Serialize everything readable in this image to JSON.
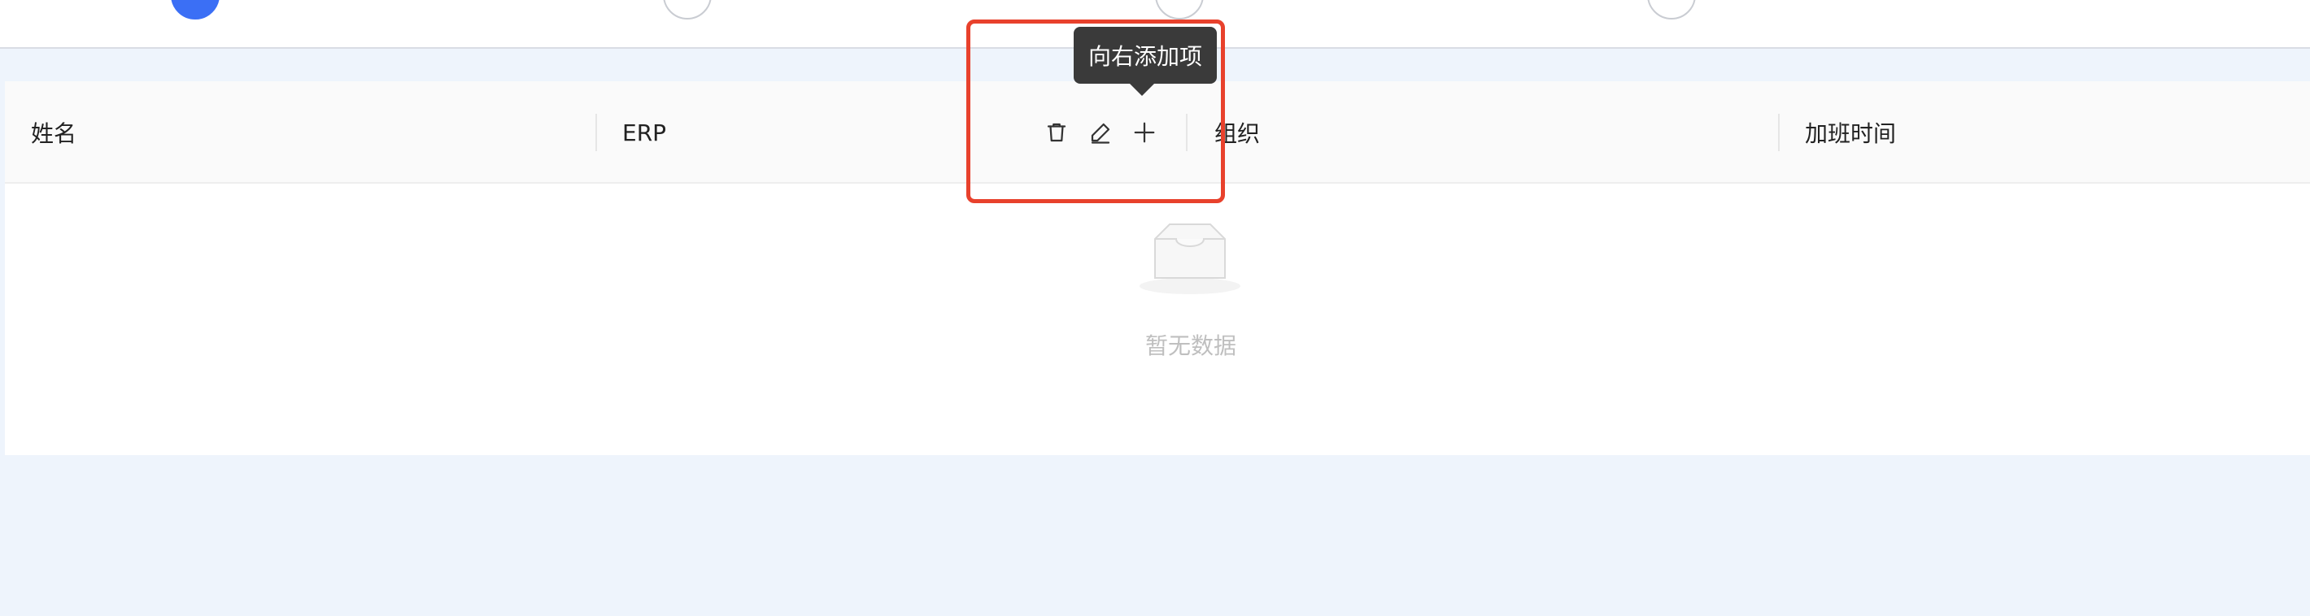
{
  "table": {
    "columns": [
      {
        "label": "姓名"
      },
      {
        "label": "ERP"
      },
      {
        "label": "组织"
      },
      {
        "label": "加班时间"
      }
    ],
    "empty_text": "暂无数据"
  },
  "tooltip": {
    "text": "向右添加项"
  },
  "icons": {
    "delete": "trash-icon",
    "edit": "pencil-icon",
    "add": "plus-icon",
    "empty": "inbox-icon"
  },
  "colors": {
    "accent": "#3b6ff5",
    "highlight": "#e8412c",
    "tooltip_bg": "#3a3a3a",
    "page_bg": "#eef4fc"
  }
}
